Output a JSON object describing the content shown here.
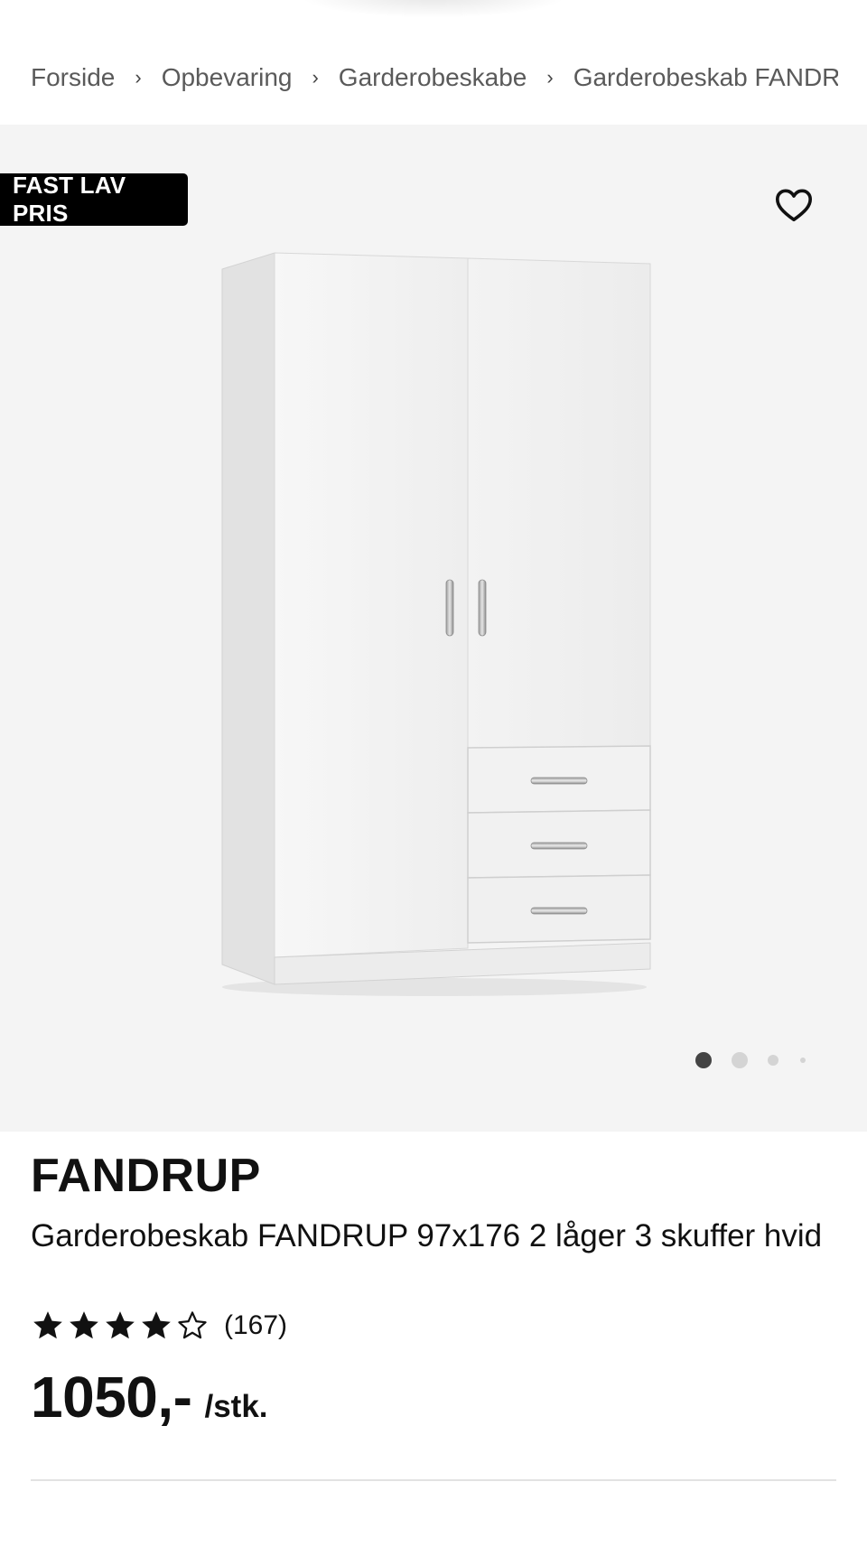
{
  "breadcrumb": {
    "items": [
      "Forside",
      "Opbevaring",
      "Garderobeskabe",
      "Garderobeskab FANDRU"
    ],
    "separator": "›"
  },
  "gallery": {
    "badge": "FAST LAV PRIS",
    "favorite_icon": "heart-outline-icon",
    "image": "white-wardrobe-2-doors-3-drawers",
    "pagination_total": 4,
    "pagination_active": 1
  },
  "product": {
    "brand": "FANDRUP",
    "title": "Garderobeskab FANDRUP 97x176 2 låger 3 skuffer hvid",
    "rating": 4,
    "rating_max": 5,
    "review_count": "(167)",
    "price": "1050,-",
    "price_unit": "/stk."
  },
  "colors": {
    "badge_bg": "#000000",
    "gallery_bg": "#f4f4f4",
    "text": "#111111",
    "breadcrumb_text": "#5a5a5a"
  }
}
